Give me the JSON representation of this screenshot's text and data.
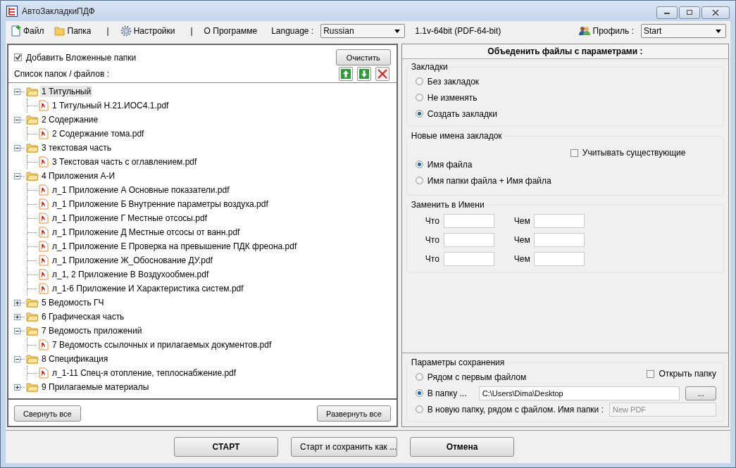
{
  "window": {
    "title": "АвтоЗакладкиПДФ"
  },
  "menu": [
    {
      "kind": "item",
      "label": "Файл"
    },
    {
      "kind": "item",
      "label": "Папка"
    },
    {
      "kind": "separator",
      "label": "|"
    },
    {
      "kind": "item",
      "label": "Настройки"
    },
    {
      "kind": "separator",
      "label": "|"
    },
    {
      "kind": "item",
      "label": "О Программе"
    }
  ],
  "language": {
    "label": "Language :",
    "value": "Russian"
  },
  "version": "1.1v-64bit (PDF-64-bit)",
  "profile": {
    "label": "Профиль :",
    "value": "Start"
  },
  "left": {
    "add_subfolders": {
      "label": "Добавить Вложенные папки",
      "checked": true
    },
    "clear_button": "Очистить",
    "list_label": "Список папок / файлов :",
    "tree": [
      {
        "label": "1 Титульный",
        "expanded": true,
        "selected": true,
        "children": [
          {
            "label": "1 Титульный Н.21.ИОС4.1.pdf"
          }
        ]
      },
      {
        "label": "2 Содержание",
        "expanded": true,
        "selected": false,
        "children": [
          {
            "label": "2 Содержание тома.pdf"
          }
        ]
      },
      {
        "label": "3 текстовая часть",
        "expanded": true,
        "selected": false,
        "children": [
          {
            "label": "3 Текстовая часть с оглавлением.pdf"
          }
        ]
      },
      {
        "label": "4 Приложения А-И",
        "expanded": true,
        "selected": false,
        "children": [
          {
            "label": "л_1 Приложение А Основные  показатели.pdf"
          },
          {
            "label": "л_1 Приложение Б  Внутренние параметры воздуха.pdf"
          },
          {
            "label": "л_1 Приложение Г Местные отсосы.pdf"
          },
          {
            "label": "л_1 Приложение Д  Местные отсосы от ванн.pdf"
          },
          {
            "label": "л_1 Приложение Е Проверка на превышение ПДК фреона.pdf"
          },
          {
            "label": "л_1 Приложение Ж_Обоснование ДУ.pdf"
          },
          {
            "label": "л_1, 2 Приложение В Воздухообмен.pdf"
          },
          {
            "label": "л_1-6 Приложение И Характеристика систем.pdf"
          }
        ]
      },
      {
        "label": "5 Ведомость ГЧ",
        "expanded": false,
        "selected": false
      },
      {
        "label": "6 Графическая часть",
        "expanded": false,
        "selected": false
      },
      {
        "label": "7 Ведомость приложений",
        "expanded": true,
        "selected": false,
        "children": [
          {
            "label": "7 Ведомость ссылочных и прилагаемых документов.pdf"
          }
        ]
      },
      {
        "label": "8 Спецификация",
        "expanded": true,
        "selected": false,
        "children": [
          {
            "label": "л_1-11  Спец-я отопление, теплоснабжение.pdf"
          }
        ]
      },
      {
        "label": "9 Прилагаемые материалы",
        "expanded": false,
        "selected": false
      }
    ],
    "collapse_button": "Свернуть все",
    "expand_button": "Развернуть все"
  },
  "right": {
    "title": "Объеденить файлы с параметрами :",
    "bookmarks": {
      "title": "Закладки",
      "options": [
        {
          "label": "Без закладок",
          "selected": false
        },
        {
          "label": "Не изменять",
          "selected": false
        },
        {
          "label": "Создать закладки",
          "selected": true
        }
      ]
    },
    "names": {
      "title": "Новые имена закладок",
      "keep_existing": {
        "label": "Учитывать существующие",
        "checked": false
      },
      "options": [
        {
          "label": "Имя файла",
          "selected": true
        },
        {
          "label": "Имя папки файла + Имя файла",
          "selected": false
        }
      ]
    },
    "replace": {
      "title": "Заменить в Имени",
      "rows": [
        {
          "what": "Что",
          "with": "Чем"
        },
        {
          "what": "Что",
          "with": "Чем"
        },
        {
          "what": "Что",
          "with": "Чем"
        }
      ]
    },
    "save": {
      "title": "Параметры сохранения",
      "open_folder": {
        "label": "Открыть папку",
        "checked": false
      },
      "options": [
        {
          "label": "Рядом с первым файлом",
          "selected": false
        },
        {
          "label": "В папку ...",
          "selected": true,
          "field": {
            "value": "C:\\Users\\Dima\\Desktop",
            "disabled": false
          },
          "button": "..."
        },
        {
          "label": "В новую папку, рядом с файлом. Имя папки :",
          "selected": false,
          "field": {
            "value": "New PDF",
            "disabled": true
          }
        }
      ]
    }
  },
  "buttons": [
    {
      "label": "СТАРТ",
      "kind": "primary"
    },
    {
      "label": "Старт и сохранить как ...",
      "kind": "normal"
    },
    {
      "label": "Отмена",
      "kind": "primary"
    }
  ]
}
